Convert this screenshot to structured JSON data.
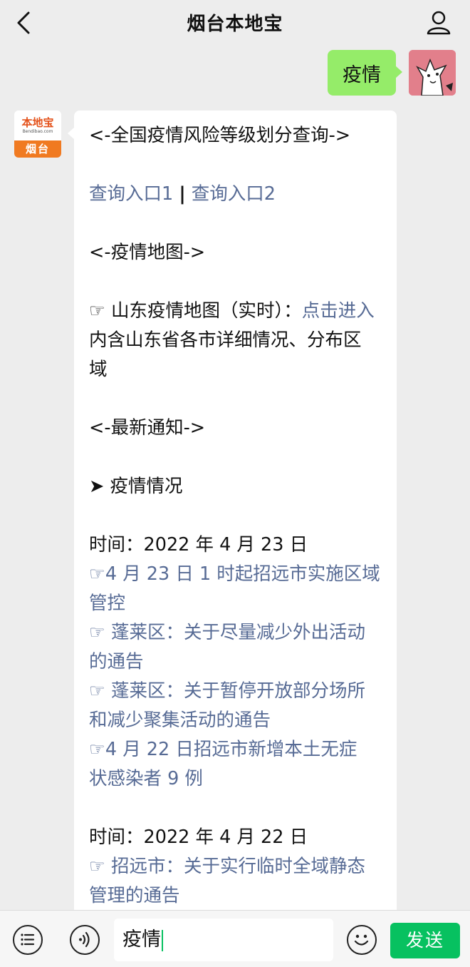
{
  "header": {
    "title": "烟台本地宝",
    "back_icon": "chevron-left-icon",
    "profile_icon": "person-icon"
  },
  "outgoing": {
    "text": "疫情"
  },
  "incoming": {
    "avatar": {
      "brand": "本地宝",
      "site": "Bendibao.com",
      "city": "烟台"
    },
    "lines": {
      "risk_header": "<-全国疫情风险等级划分查询->",
      "query_link_1": "查询入口1",
      "separator": "|",
      "query_link_2": "查询入口2",
      "map_header": "<-疫情地图->",
      "map_label": "☞ 山东疫情地图（实时）：",
      "map_link": "点击进入",
      "map_desc_1": "内含山东省各市详细情况、分布区",
      "map_desc_2": "域",
      "notice_header": "<-最新通知->",
      "situation_header": "➤ 疫情情况",
      "date_1": "时间：2022 年 4 月 23 日",
      "news_1_a": "☞4 月 23 日 1 时起招远市实施区域",
      "news_1_b": "管控",
      "news_2_a": "☞ 蓬莱区：关于尽量减少外出活动",
      "news_2_b": "的通告",
      "news_3_a": "☞ 蓬莱区：关于暂停开放部分场所",
      "news_3_b": "和减少聚集活动的通告",
      "news_4_a": "☞4 月 22 日招远市新增本土无症",
      "news_4_b": "状感染者 9 例",
      "date_2": "时间：2022 年 4 月 22 日",
      "news_5_a": "☞ 招远市：关于实行临时全域静态",
      "news_5_b": "管理的通告"
    }
  },
  "input_bar": {
    "menu_icon": "menu-list-icon",
    "voice_icon": "voice-icon",
    "input_value": "疫情",
    "emoji_icon": "emoji-icon",
    "send_label": "发送"
  },
  "colors": {
    "link": "#576b95",
    "outgoing_bubble": "#95ec69",
    "send_button": "#07c160",
    "background": "#ededed"
  }
}
